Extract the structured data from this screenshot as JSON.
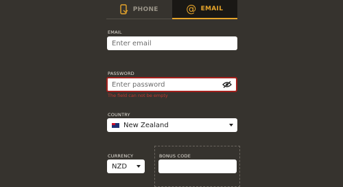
{
  "tabs": {
    "phone": "PHONE",
    "email": "EMAIL"
  },
  "form": {
    "email": {
      "label": "EMAIL",
      "placeholder": "Enter email",
      "value": ""
    },
    "password": {
      "label": "PASSWORD",
      "placeholder": "Enter password",
      "value": "",
      "error": "The field can not be empty"
    },
    "country": {
      "label": "COUNTRY",
      "value": "New Zealand"
    },
    "currency": {
      "label": "CURRENCY",
      "value": "NZD"
    },
    "bonus": {
      "label": "BONUS CODE",
      "value": ""
    }
  },
  "colors": {
    "background": "#36332e",
    "accent": "#e7a52b",
    "error": "#a3201c"
  }
}
